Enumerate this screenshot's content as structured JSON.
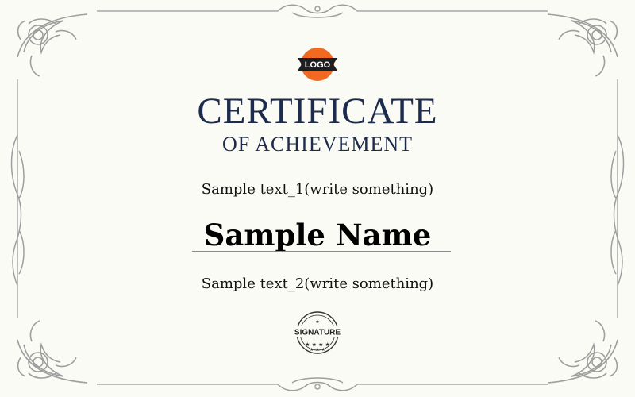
{
  "logo": {
    "text": "LOGO"
  },
  "title": {
    "line1": "CERTIFICATE",
    "line2": "OF ACHIEVEMENT"
  },
  "body": {
    "text1": "Sample text_1(write something)",
    "name": "Sample Name",
    "text2": "Sample text_2(write something)"
  },
  "seal": {
    "text": "SIGNATURE"
  },
  "colors": {
    "title": "#1d2b4c",
    "logo": "#f26a21",
    "ornament": "#9e9e9e",
    "background": "#fbfbf6"
  }
}
